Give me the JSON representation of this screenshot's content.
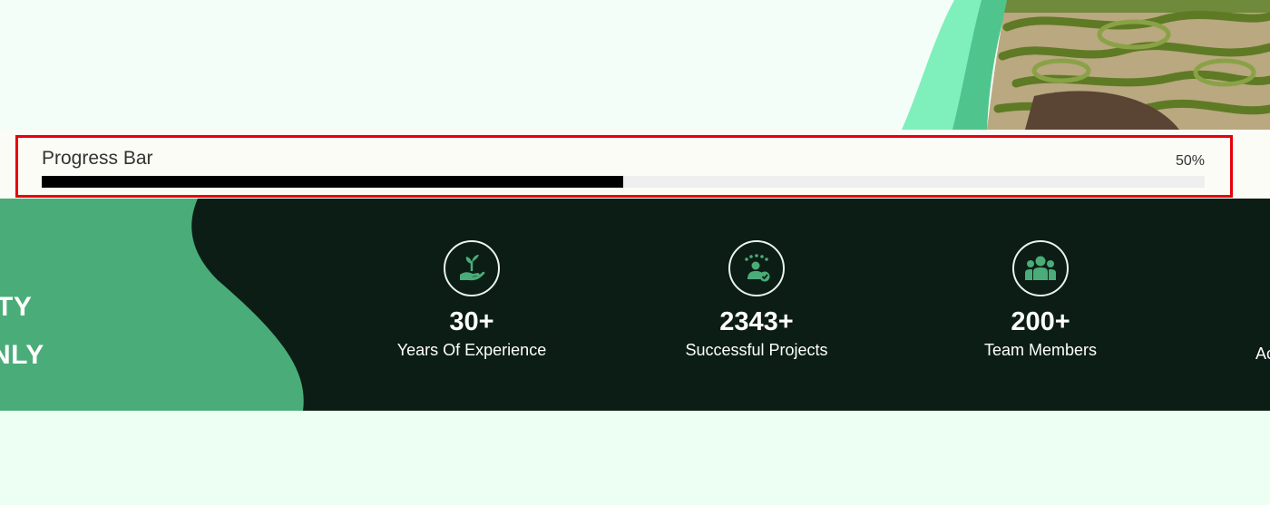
{
  "hero": {
    "image_name": "garden-maze-image",
    "accent_color": "#5de3a3"
  },
  "progress": {
    "title": "Progress Bar",
    "percent_label": "50%",
    "value_fraction": 0.5,
    "fill_color": "#000000",
    "track_color": "#efefef",
    "highlight_color": "#e8000b"
  },
  "side_text": {
    "line1": "TY",
    "line2": "NLY"
  },
  "stats": [
    {
      "icon": "plant-hand-icon",
      "value": "30+",
      "label": "Years Of Experience"
    },
    {
      "icon": "rated-person-icon",
      "value": "2343+",
      "label": "Successful Projects"
    },
    {
      "icon": "team-icon",
      "value": "200+",
      "label": "Team Members"
    }
  ],
  "stat_cut_label": "Ac",
  "colors": {
    "band": "#0b1d15",
    "blob": "#4aac78",
    "icon_green": "#4aac78"
  }
}
